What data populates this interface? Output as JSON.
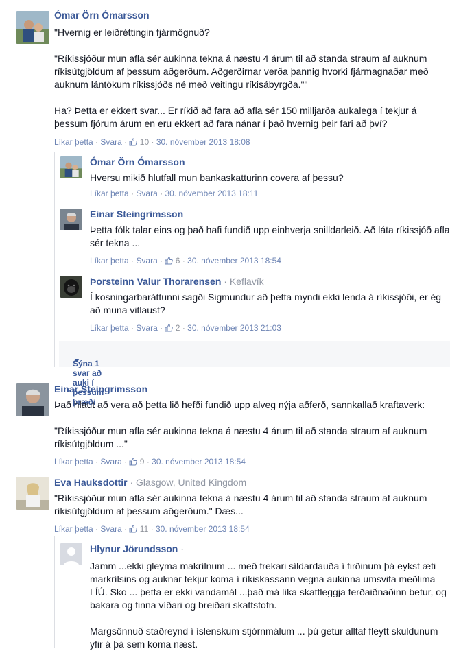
{
  "meta_labels": {
    "like": "Líkar þetta",
    "reply": "Svara",
    "sep": "·"
  },
  "colors": {
    "name_link": "#3b5998",
    "meta_link": "#6d84b4",
    "meta_text": "#90949c",
    "thread_bg": "#f6f7f9"
  },
  "comments": [
    {
      "author": "Ómar Örn Ómarsson",
      "paragraphs": [
        "\"Hvernig er leiðréttingin fjármögnuð?",
        "\"Ríkissjóður mun afla sér aukinna tekna á næstu 4 árum til að standa straum af auknum ríkisútgjöldum af þessum aðgerðum. Aðgerðirnar verða þannig hvorki fjármagnaðar með auknum lántökum ríkissjóðs né með veitingu ríkisábyrgða.\"\"",
        "Ha? Þetta er ekkert svar... Er ríkið að fara að afla sér 150 milljarða aukalega í tekjur á þessum fjórum árum en eru ekkert að fara nánar í það hvernig þeir fari að því?"
      ],
      "likes": "10",
      "date": "30. nóvember 2013 18:08",
      "replies": [
        {
          "author": "Ómar Örn Ómarsson",
          "paragraphs": [
            "Hversu mikið hlutfall mun bankaskatturinn covera af þessu?"
          ],
          "likes": "",
          "date": "30. nóvember 2013 18:11"
        },
        {
          "author": "Einar Steingrimsson",
          "paragraphs": [
            "Þetta fólk talar eins og það hafi fundið upp einhverja snilldarleið. Að láta ríkissjóð afla sér tekna ..."
          ],
          "likes": "6",
          "date": "30. nóvember 2013 18:54"
        },
        {
          "author": "Þorsteinn Valur Thorarensen",
          "location": "Keflavík",
          "paragraphs": [
            "Í kosningarbaráttunni sagði Sigmundur að þetta myndi ekki lenda á ríkissjóði, er ég að muna vitlaust?"
          ],
          "likes": "2",
          "date": "30. nóvember 2013 21:03"
        }
      ],
      "more_replies": "Sýna 1 svar að auki í þessum þræði"
    },
    {
      "author": "Einar Steingrimsson",
      "paragraphs": [
        "Það hlaut að vera að þetta lið hefði fundið upp alveg nýja aðferð, sannkallað kraftaverk:",
        "\"Ríkissjóður mun afla sér aukinna tekna á næstu 4 árum til að standa straum af auknum ríkisútgjöldum ...\""
      ],
      "likes": "9",
      "date": "30. nóvember 2013 18:54"
    },
    {
      "author": "Eva Hauksdottir",
      "location": "Glasgow, United Kingdom",
      "paragraphs": [
        "\"Ríkissjóður mun afla sér aukinna tekna á næstu 4 árum til að standa straum af auknum ríkisútgjöldum af þessum aðgerðum.\" Dæs..."
      ],
      "likes": "11",
      "date": "30. nóvember 2013 18:54",
      "replies": [
        {
          "author": "Hlynur Jörundsson",
          "paragraphs": [
            "Jamm ...ekki gleyma makrílnum ... með frekari síldardauða í firðinum þá eykst æti markrílsins og auknar tekjur koma í ríkiskassann vegna aukinna umsvifa meðlima LÍÚ. Sko ... þetta er ekki vandamál ...það má líka skattleggja ferðaiðnaðinn betur, og bakara og finna víðari og breiðari skattstofn.",
            "Margsönnuð staðreynd í íslenskum stjórnmálum ... þú getur alltaf fleytt skuldunum yfir á þá sem koma næst."
          ]
        }
      ]
    }
  ]
}
